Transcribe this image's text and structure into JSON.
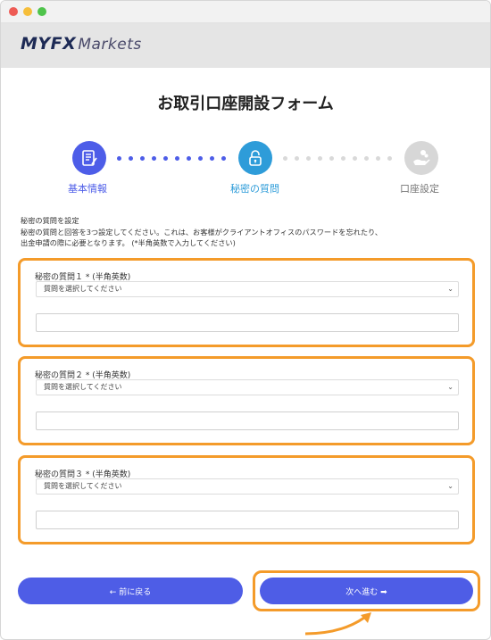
{
  "window": {
    "traffic_lights": [
      "close",
      "minimize",
      "zoom"
    ]
  },
  "header": {
    "logo_prefix": "MYF",
    "logo_x": "X",
    "logo_suffix": "Markets"
  },
  "form": {
    "title": "お取引口座開設フォーム"
  },
  "stepper": {
    "steps": [
      {
        "label": "基本情報",
        "icon": "document-form-icon",
        "state": "complete",
        "color": "#4d5de8"
      },
      {
        "label": "秘密の質問",
        "icon": "lock-icon",
        "state": "active",
        "color": "#2e9cd9"
      },
      {
        "label": "口座設定",
        "icon": "hand-coins-icon",
        "state": "inactive",
        "color": "#d7d7d7"
      }
    ]
  },
  "intro": {
    "heading": "秘密の質問を設定",
    "line1": "秘密の質問と回答を3つ設定してください。これは、お客様がクライアントオフィスのパスワードを忘れたり、",
    "line2": "出金申請の際に必要となります。 (*半角英数で入力してください)"
  },
  "questions": [
    {
      "label": "秘密の質問１ * (半角英数)",
      "select_value": "質問を選択してください",
      "answer_value": ""
    },
    {
      "label": "秘密の質問２ * (半角英数)",
      "select_value": "質問を選択してください",
      "answer_value": ""
    },
    {
      "label": "秘密の質問３ * (半角英数)",
      "select_value": "質問を選択してください",
      "answer_value": ""
    }
  ],
  "buttons": {
    "back_label": "← 前に戻る",
    "next_label": "次へ進む ➡"
  },
  "colors": {
    "primary": "#4e5de6",
    "highlight": "#f49b2a",
    "active_step": "#2e9cd9"
  }
}
